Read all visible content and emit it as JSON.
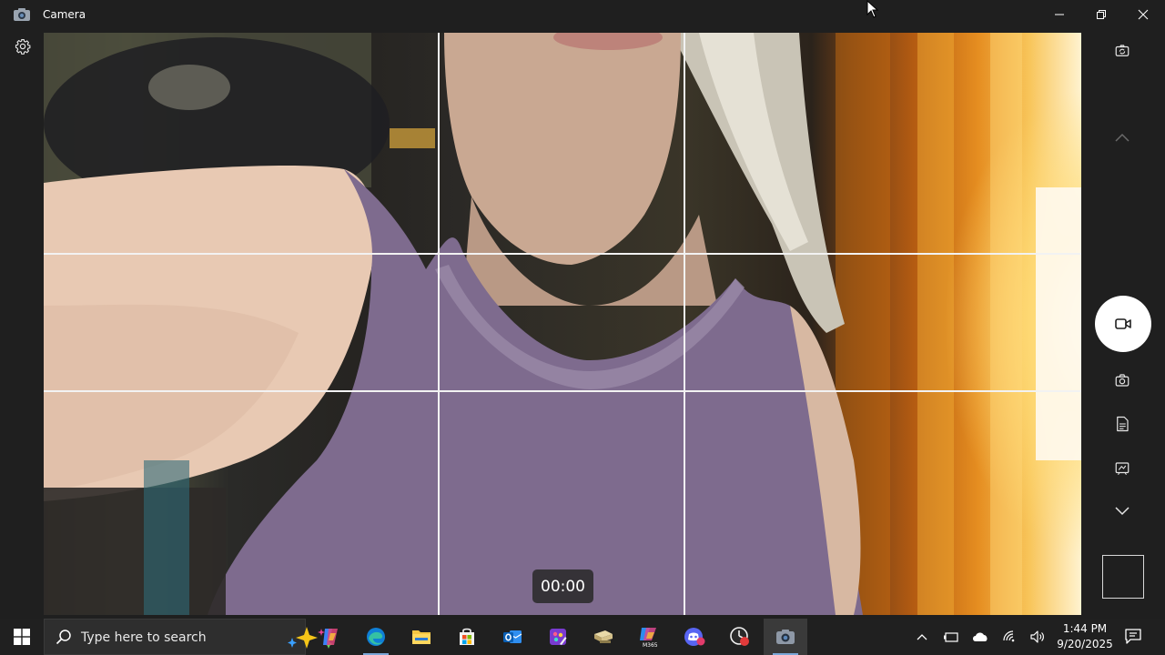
{
  "window": {
    "title": "Camera",
    "icon": "camera-app-icon",
    "controls": [
      "minimize-icon",
      "restore-icon",
      "close-icon"
    ]
  },
  "toolbar": {
    "settings_icon": "gear-icon"
  },
  "viewfinder": {
    "timer": "00:00",
    "grid": "rule-of-thirds"
  },
  "side_controls": {
    "icons": [
      "switch-camera-icon",
      "chevron-up-icon",
      "video-icon",
      "photo-camera-icon",
      "document-icon",
      "whiteboard-icon",
      "chevron-down-icon"
    ],
    "active_mode": "video"
  },
  "taskbar": {
    "search_placeholder": "Type here to search",
    "apps": [
      "copilot-icon",
      "edge-icon",
      "file-explorer-icon",
      "store-icon",
      "outlook-icon",
      "paint-icon",
      "file-icon",
      "m365-icon",
      "discord-icon",
      "clock-app-icon",
      "camera-icon"
    ],
    "m365_label": "M365",
    "clock_time": "1:44 PM",
    "clock_date": "9/20/2025",
    "colors": {
      "taskbar_bg": "#202020",
      "accent": "#7aa7d8"
    }
  }
}
